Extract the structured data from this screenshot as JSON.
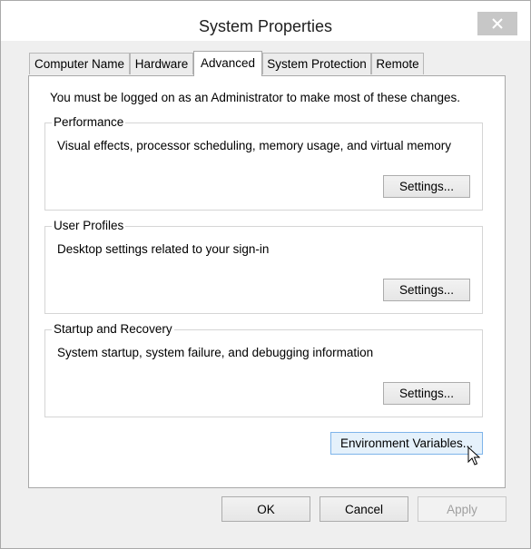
{
  "window": {
    "title": "System Properties"
  },
  "tabs": [
    {
      "label": "Computer Name",
      "active": false
    },
    {
      "label": "Hardware",
      "active": false
    },
    {
      "label": "Advanced",
      "active": true
    },
    {
      "label": "System Protection",
      "active": false
    },
    {
      "label": "Remote",
      "active": false
    }
  ],
  "intro_text": "You must be logged on as an Administrator to make most of these changes.",
  "groups": {
    "performance": {
      "title": "Performance",
      "description": "Visual effects, processor scheduling, memory usage, and virtual memory",
      "button": "Settings..."
    },
    "user_profiles": {
      "title": "User Profiles",
      "description": "Desktop settings related to your sign-in",
      "button": "Settings..."
    },
    "startup_recovery": {
      "title": "Startup and Recovery",
      "description": "System startup, system failure, and debugging information",
      "button": "Settings..."
    }
  },
  "env_button": "Environment Variables...",
  "footer": {
    "ok": "OK",
    "cancel": "Cancel",
    "apply": "Apply",
    "apply_enabled": false
  },
  "icons": {
    "close": "close-icon",
    "cursor": "mouse-pointer-icon"
  }
}
